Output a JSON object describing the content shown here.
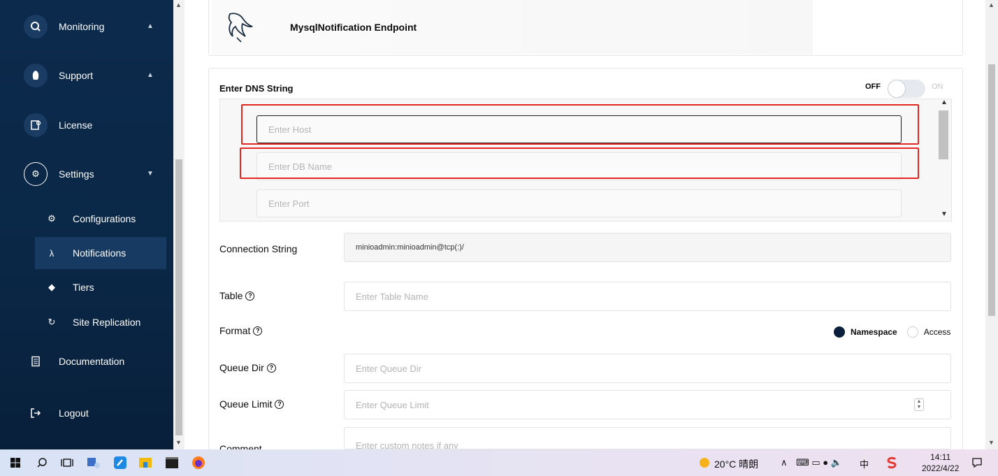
{
  "sidebar": {
    "items": [
      {
        "label": "Monitoring",
        "icon": "search-chart-icon"
      },
      {
        "label": "Support",
        "icon": "support-icon"
      },
      {
        "label": "License",
        "icon": "license-icon"
      },
      {
        "label": "Settings",
        "icon": "gear-icon"
      }
    ],
    "sub_items": [
      {
        "label": "Configurations",
        "icon": "gear-icon"
      },
      {
        "label": "Notifications",
        "icon": "lambda-icon"
      },
      {
        "label": "Tiers",
        "icon": "layers-icon"
      },
      {
        "label": "Site Replication",
        "icon": "sync-icon"
      }
    ],
    "bottom_items": [
      {
        "label": "Documentation",
        "icon": "document-icon"
      },
      {
        "label": "Logout",
        "icon": "logout-icon"
      }
    ]
  },
  "header": {
    "title": "MysqlNotification Endpoint"
  },
  "dns": {
    "label": "Enter DNS String",
    "toggle_off": "OFF",
    "toggle_on": "ON",
    "host_placeholder": "Enter Host",
    "db_placeholder": "Enter DB Name",
    "port_placeholder": "Enter Port"
  },
  "form": {
    "connection_label": "Connection String",
    "connection_value": "minioadmin:minioadmin@tcp(:)/",
    "table_label": "Table",
    "table_placeholder": "Enter Table Name",
    "format_label": "Format",
    "format_options": [
      "Namespace",
      "Access"
    ],
    "format_selected": "Namespace",
    "queue_dir_label": "Queue Dir",
    "queue_dir_placeholder": "Enter Queue Dir",
    "queue_limit_label": "Queue Limit",
    "queue_limit_placeholder": "Enter Queue Limit",
    "comment_label": "Comment",
    "comment_placeholder": "Enter custom notes if any"
  },
  "taskbar": {
    "weather": "20°C 晴朗",
    "time": "14:11",
    "date": "2022/4/22"
  },
  "colors": {
    "sidebar_bg": "#0c2a4c",
    "active_item": "#163a61",
    "highlight": "#e3261f"
  }
}
